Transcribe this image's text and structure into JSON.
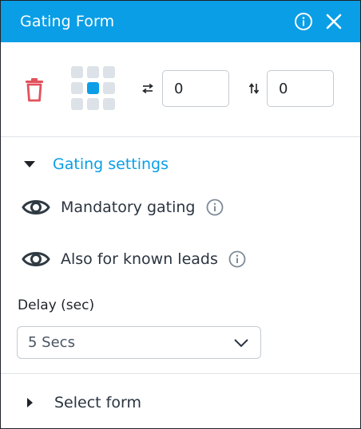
{
  "header": {
    "title": "Gating Form",
    "info_icon": "info-circle-icon",
    "close_icon": "close-icon"
  },
  "toolbar": {
    "delete_icon": "trash-icon",
    "position_grid": {
      "rows": 3,
      "cols": 3,
      "selected_index": 4
    },
    "offset_x": {
      "icon": "horizontal-arrows-icon",
      "value": "0"
    },
    "offset_y": {
      "icon": "vertical-arrows-icon",
      "value": "0"
    }
  },
  "gating_settings": {
    "label": "Gating settings",
    "options": [
      {
        "label": "Mandatory gating",
        "icon": "eye-icon",
        "info_icon": "info-circle-icon"
      },
      {
        "label": "Also for known leads",
        "icon": "eye-icon",
        "info_icon": "info-circle-icon"
      }
    ],
    "delay": {
      "label": "Delay (sec)",
      "selected": "5 Secs"
    }
  },
  "select_form": {
    "label": "Select form"
  },
  "colors": {
    "accent": "#0a9ee6",
    "danger": "#e2525c",
    "text": "#2b3440",
    "grid_inactive": "#dde2e8"
  }
}
